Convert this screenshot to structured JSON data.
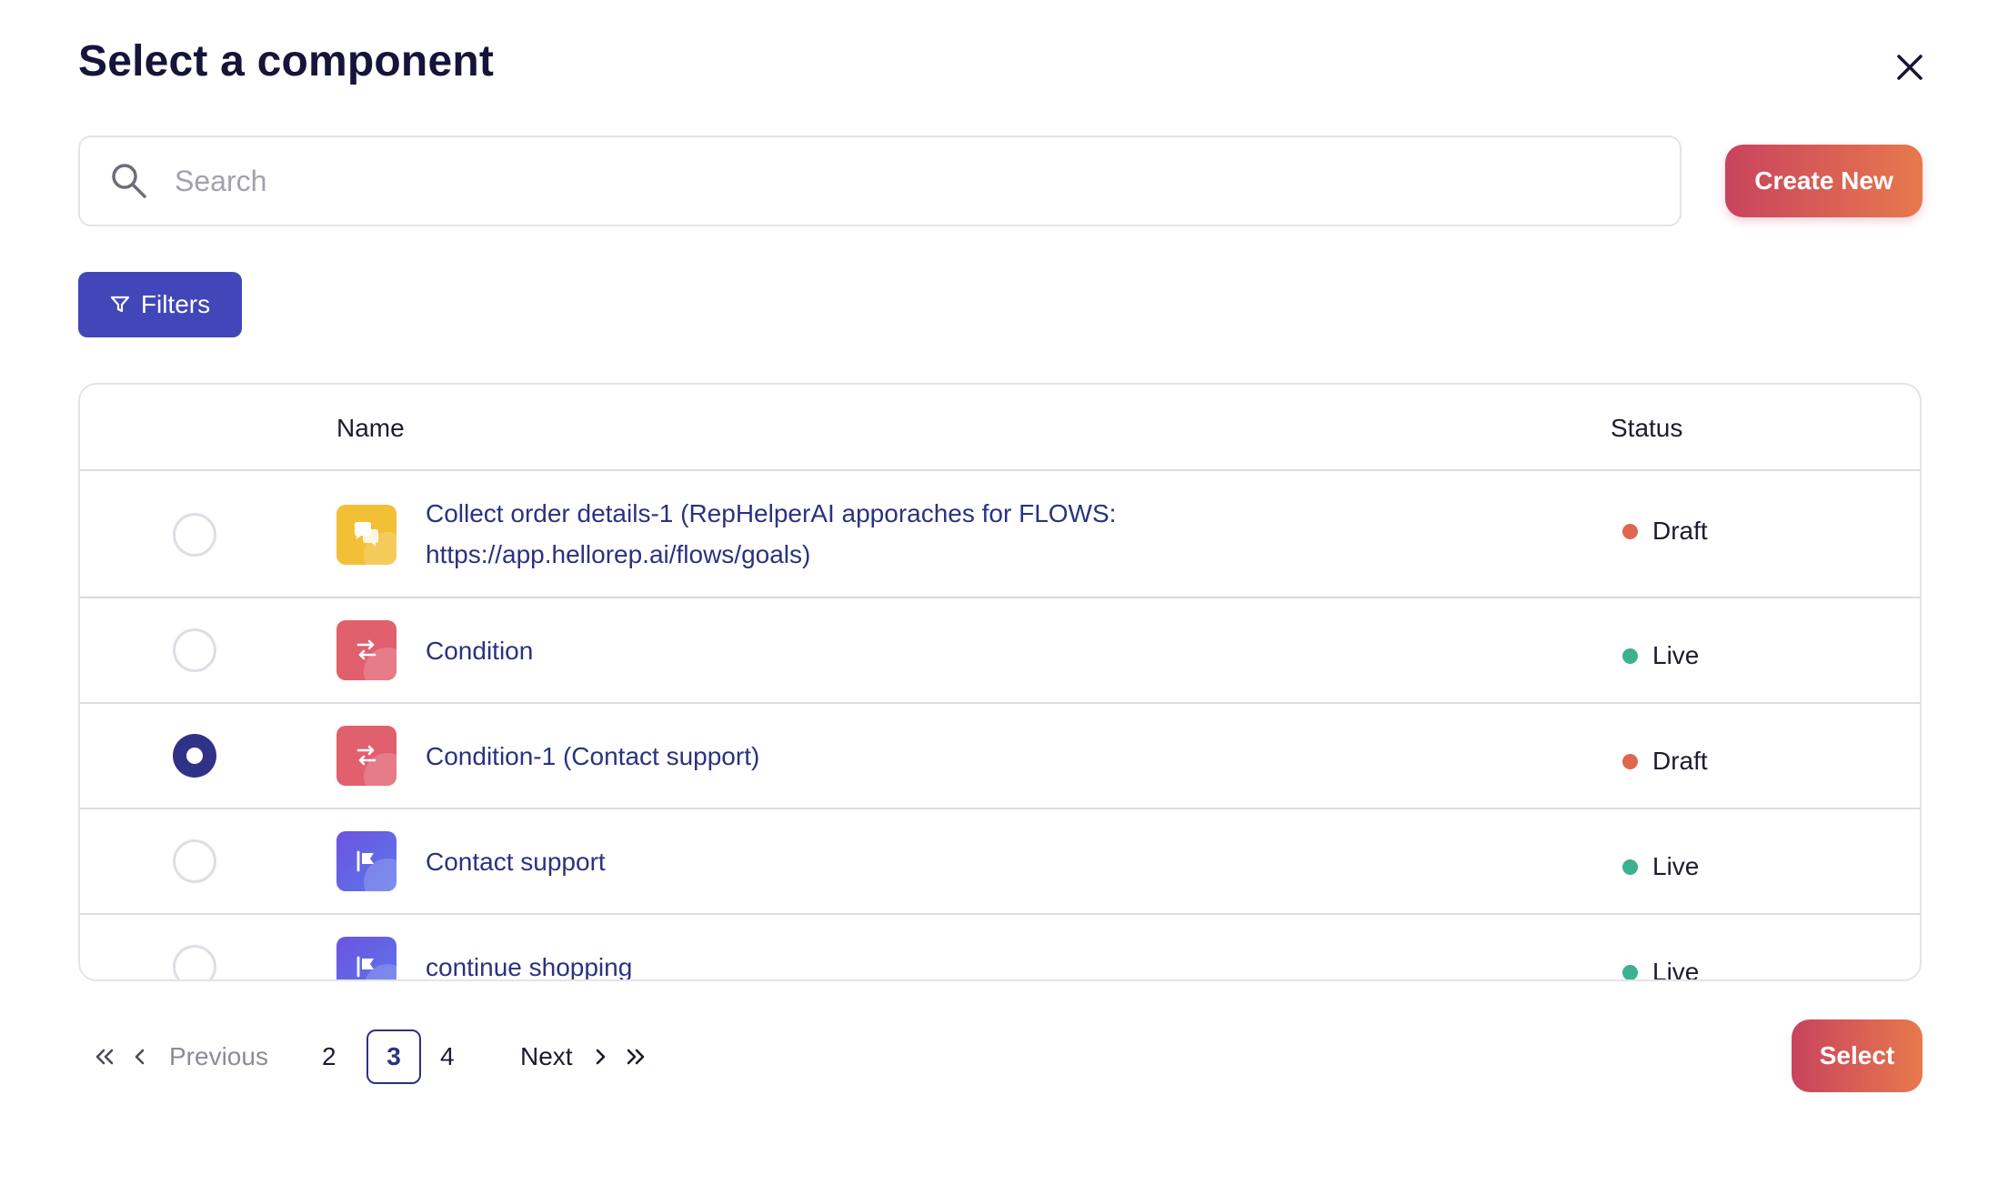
{
  "dialog": {
    "title": "Select a component",
    "close_icon": "close-icon"
  },
  "search": {
    "placeholder": "Search",
    "value": "",
    "icon": "search-icon"
  },
  "actions": {
    "create_new_label": "Create New",
    "filters_label": "Filters",
    "select_label": "Select"
  },
  "table": {
    "columns": {
      "name": "Name",
      "status": "Status"
    },
    "rows": [
      {
        "name_line1": "Collect order details-1 (RepHelperAI apporaches for FLOWS:",
        "name_line2": "https://app.hellorep.ai/flows/goals)",
        "status": "Draft",
        "selected": false,
        "icon": "chat-bubbles-icon",
        "icon_color": "#f2c037"
      },
      {
        "name": "Condition",
        "status": "Live",
        "selected": false,
        "icon": "condition-icon",
        "icon_color": "#e0606d"
      },
      {
        "name": "Condition-1 (Contact support)",
        "status": "Draft",
        "selected": true,
        "icon": "condition-icon",
        "icon_color": "#e0606d"
      },
      {
        "name": "Contact support",
        "status": "Live",
        "selected": false,
        "icon": "flag-icon",
        "icon_color": "#6c54e0"
      },
      {
        "name": "continue shopping",
        "status": "Live",
        "selected": false,
        "icon": "flag-icon",
        "icon_color": "#6c54e0"
      }
    ]
  },
  "pagination": {
    "previous_label": "Previous",
    "next_label": "Next",
    "pages": [
      "2",
      "3",
      "4"
    ],
    "current_page": "3"
  },
  "colors": {
    "primary": "#4147b8",
    "accent_gradient_start": "#c9435e",
    "accent_gradient_end": "#e7794d",
    "draft": "#e0664f",
    "live": "#3bb28f",
    "link_text": "#2b3280"
  }
}
